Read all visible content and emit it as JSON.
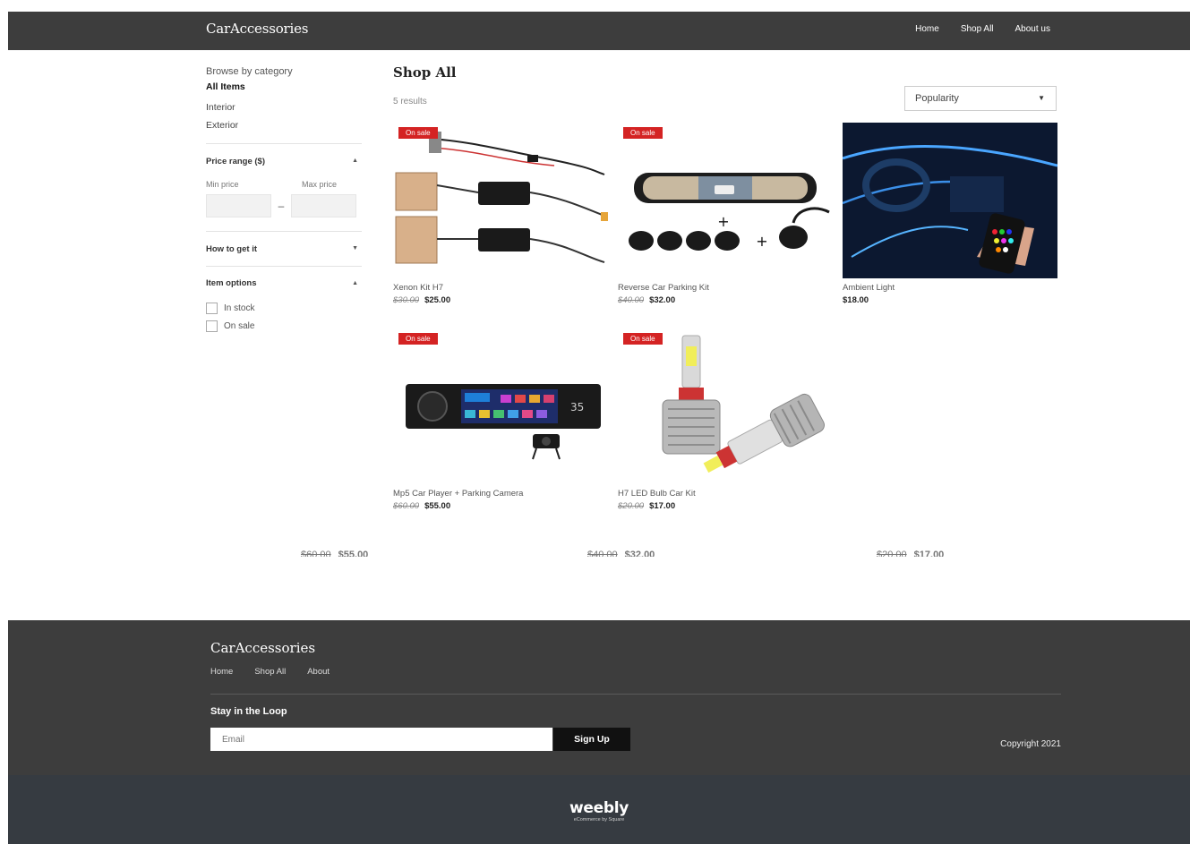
{
  "header": {
    "brand": "CarAccessories",
    "nav": [
      "Home",
      "Shop All",
      "About us"
    ]
  },
  "sidebar": {
    "browse_title": "Browse by category",
    "categories": [
      "All Items",
      "Interior",
      "Exterior"
    ],
    "price_range": {
      "title": "Price range ($)",
      "min_label": "Min price",
      "max_label": "Max price"
    },
    "how_to_get": {
      "title": "How to get it"
    },
    "item_options": {
      "title": "Item options",
      "in_stock": "In stock",
      "on_sale": "On sale"
    }
  },
  "main": {
    "title": "Shop All",
    "results": "5 results",
    "sort": "Popularity",
    "badge": "On sale",
    "products": [
      {
        "name": "Xenon Kit H7",
        "old_price": "$30.00",
        "price": "$25.00"
      },
      {
        "name": "Reverse Car Parking Kit",
        "old_price": "$40.00",
        "price": "$32.00"
      },
      {
        "name": "Ambient Light",
        "old_price": "",
        "price": "$18.00"
      },
      {
        "name": "Mp5 Car Player + Parking Camera",
        "old_price": "$60.00",
        "price": "$55.00"
      },
      {
        "name": "H7 LED Bulb Car Kit",
        "old_price": "$20.00",
        "price": "$17.00"
      }
    ],
    "ghost": [
      {
        "old_price": "$60.00",
        "price": "$55.00"
      },
      {
        "old_price": "$40.00",
        "price": "$32.00"
      },
      {
        "old_price": "$20.00",
        "price": "$17.00"
      }
    ]
  },
  "footer": {
    "brand": "CarAccessories",
    "nav": [
      "Home",
      "Shop All",
      "About"
    ],
    "loop_title": "Stay in the Loop",
    "email_placeholder": "Email",
    "signup": "Sign Up",
    "copyright": "Copyright 2021"
  },
  "bottom": {
    "logo": "weebly",
    "tagline": "eCommerce by Square"
  }
}
